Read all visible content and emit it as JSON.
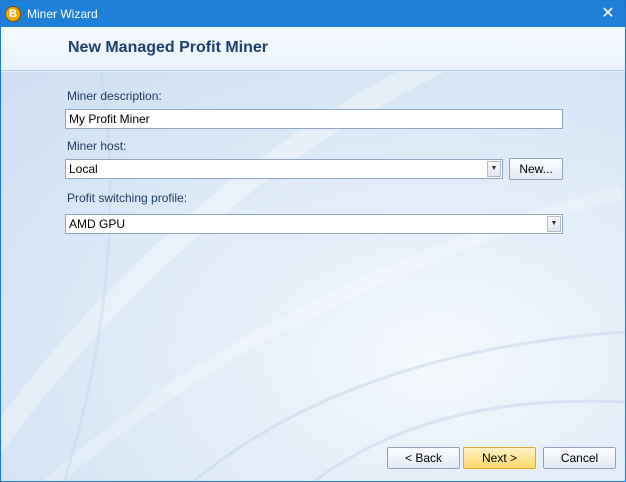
{
  "window": {
    "title": "Miner Wizard",
    "icon": "bitcoin-icon",
    "close_glyph": "✕"
  },
  "header": {
    "title": "New Managed Profit Miner"
  },
  "form": {
    "description_label": "Miner description:",
    "description_value": "My Profit Miner",
    "host_label": "Miner host:",
    "host_value": "Local",
    "host_new_label": "New...",
    "profile_label": "Profit switching profile:",
    "profile_value": "AMD GPU"
  },
  "footer": {
    "back_label": "< Back",
    "next_label": "Next >",
    "cancel_label": "Cancel"
  },
  "colors": {
    "titlebar": "#1e7fd8",
    "header_text": "#1e3f6e",
    "primary_button": "#fbd86a"
  }
}
